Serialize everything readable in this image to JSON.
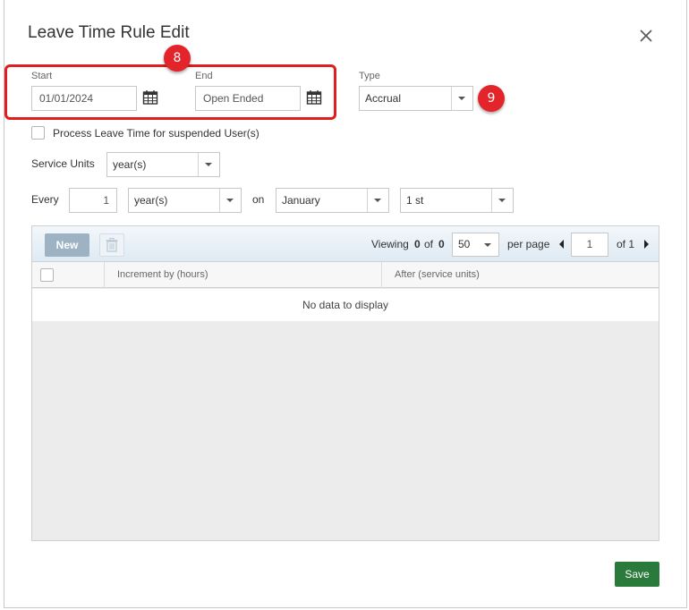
{
  "dialog": {
    "title": "Leave Time Rule Edit"
  },
  "dates": {
    "start_label": "Start",
    "start_value": "01/01/2024",
    "end_label": "End",
    "end_value": "Open Ended"
  },
  "type": {
    "label": "Type",
    "value": "Accrual"
  },
  "callouts": {
    "badge_1": "8",
    "badge_2": "9"
  },
  "suspended": {
    "label": "Process Leave Time for suspended User(s)",
    "checked": false
  },
  "service_units": {
    "label": "Service Units",
    "value": "year(s)"
  },
  "every": {
    "label": "Every",
    "count": "1",
    "unit": "year(s)",
    "on_label": "on",
    "month": "January",
    "day": "1 st"
  },
  "grid": {
    "new_label": "New",
    "viewing_label": "Viewing",
    "viewing_from": "0",
    "viewing_of": "of",
    "viewing_total": "0",
    "page_size": "50",
    "per_page_label": "per page",
    "page_number": "1",
    "page_of_label": "of 1",
    "columns": [
      "Increment by (hours)",
      "After (service units)"
    ],
    "empty_text": "No data to display"
  },
  "footer": {
    "save_label": "Save"
  },
  "colors": {
    "accent_red": "#e4242b",
    "save_green": "#2a7a3b",
    "new_button": "#9db3c4"
  },
  "icons": [
    "close-icon",
    "calendar-icon",
    "chevron-down-icon",
    "trash-icon",
    "triangle-left-icon",
    "triangle-right-icon"
  ]
}
